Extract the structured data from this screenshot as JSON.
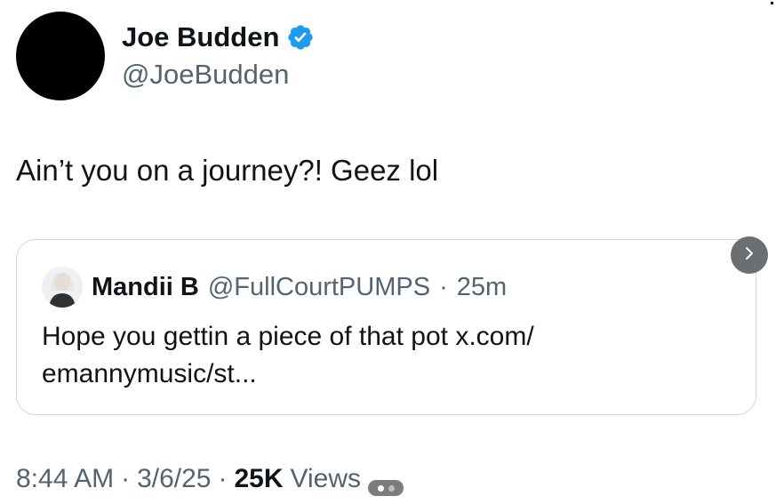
{
  "author": {
    "name": "Joe Budden",
    "handle": "@JoeBudden",
    "verified": true
  },
  "tweet": {
    "text": "Ain’t you on a journey?! Geez lol"
  },
  "quoted_tweet": {
    "name": "Mandii B",
    "handle": "@FullCourtPUMPS",
    "separator": "·",
    "time": "25m",
    "text": "Hope you gettin a piece of that pot x.com/ emannymusic/st..."
  },
  "meta": {
    "time": "8:44 AM",
    "sep1": "·",
    "date": "3/6/25",
    "sep2": "·",
    "views_count": "25K",
    "views_label": "Views"
  },
  "colors": {
    "verified_badge": "#1d9bf0",
    "secondary_text": "#536471",
    "primary_text": "#0f1419",
    "card_border": "#cfd9de"
  },
  "icons": {
    "verified": "verified-badge-icon",
    "next": "chevron-right-icon"
  }
}
